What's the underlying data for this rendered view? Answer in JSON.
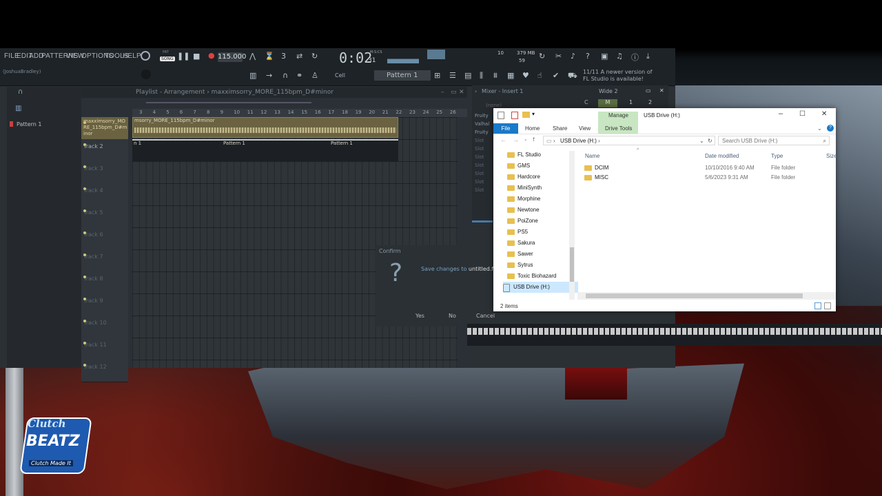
{
  "menu": [
    "FILE",
    "EDIT",
    "ADD",
    "PATTERNS",
    "VIEW",
    "OPTIONS",
    "TOOLS",
    "HELP"
  ],
  "transport": {
    "mode_pat": "PAT",
    "mode_song": "SONG",
    "tempo": "115.000",
    "time": "0:02",
    "time_sub": "31",
    "time_unit": "M:S:CS",
    "cpu": "10",
    "mem": "379 MB",
    "poly": "59"
  },
  "user": "(JoshuaBradley)",
  "toolbar": {
    "cell_label": "Cell",
    "pattern_label": "Pattern 1",
    "version_notice_line1": "11/11  A newer version of",
    "version_notice_line2": "FL Studio is available!"
  },
  "channel": {
    "pattern_name": "Pattern 1"
  },
  "playlist": {
    "title": "Playlist - Arrangement  ›  maxximsorry_MORE_115bpm_D#minor",
    "ruler": [
      "3",
      "4",
      "5",
      "6",
      "7",
      "8",
      "9",
      "10",
      "11",
      "12",
      "13",
      "14",
      "15",
      "16",
      "17",
      "18",
      "19",
      "20",
      "21",
      "22",
      "23",
      "24",
      "25",
      "26"
    ],
    "tracks": [
      "maxximsorry_MORE_115bpm_D#minor",
      "Track 2",
      "Track 3",
      "Track 4",
      "Track 5",
      "Track 6",
      "Track 7",
      "Track 8",
      "Track 9",
      "Track 10",
      "Track 11",
      "Track 12"
    ],
    "audio_clip": "msorry_MORE_115bpm_D#minor",
    "pattern_clips": [
      "n 1",
      "Pattern 1",
      "Pattern 1"
    ]
  },
  "confirm": {
    "title": "Confirm",
    "question_mark": "?",
    "message": "Save changes to",
    "filename": "untitled.flp",
    "yes": "Yes",
    "no": "No",
    "cancel": "Cancel"
  },
  "mixer": {
    "title": "Mixer - Insert 1",
    "preset": "Wide 2",
    "none": "(none)",
    "c": "C",
    "m": "M",
    "one": "1",
    "two": "2",
    "slots": [
      "Fruity",
      "Valhal",
      "Fruity",
      "Slot",
      "Slot",
      "Slot",
      "Slot",
      "Slot",
      "Slot",
      "Slot"
    ]
  },
  "explorer": {
    "title": "USB Drive (H:)",
    "tabs": {
      "file": "File",
      "home": "Home",
      "share": "Share",
      "view": "View",
      "manage": "Manage",
      "drive_tools": "Drive Tools"
    },
    "address": "USB Drive (H:)",
    "search_placeholder": "Search USB Drive (H:)",
    "nav": [
      "FL Studio",
      "GMS",
      "Hardcore",
      "MiniSynth",
      "Morphine",
      "Newtone",
      "PoiZone",
      "PS5",
      "Sakura",
      "Sawer",
      "Sytrus",
      "Toxic Biohazard",
      "USB Drive (H:)"
    ],
    "columns": {
      "name": "Name",
      "date": "Date modified",
      "type": "Type",
      "size": "Size"
    },
    "files": [
      {
        "name": "DCIM",
        "date": "10/10/2016 9:40 AM",
        "type": "File folder"
      },
      {
        "name": "MISC",
        "date": "5/6/2023 9:31 AM",
        "type": "File folder"
      }
    ],
    "status": "2 items"
  },
  "logo": {
    "line1": "Clutch",
    "line2": "BEATZ",
    "line3": "Clutch Made It"
  }
}
